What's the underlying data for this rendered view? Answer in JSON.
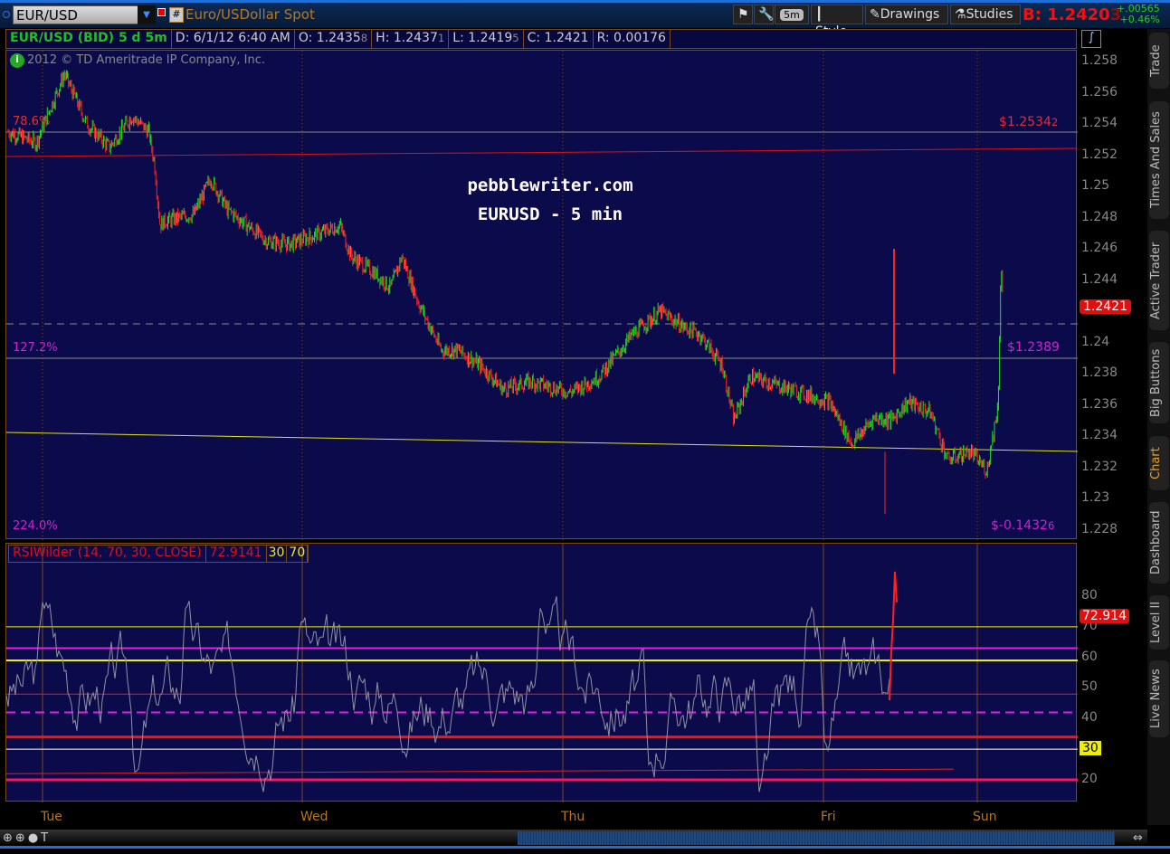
{
  "toolbar": {
    "symbol": "EUR/USD",
    "description": "Euro/USDollar Spot",
    "hash": "#",
    "timeframe": "5m",
    "style": "Style",
    "drawings": "Drawings",
    "studies": "Studies",
    "bid_label": "B:",
    "bid": "1.2420",
    "bid_small": "3",
    "change": "+.00565",
    "change_pct": "+0.46%"
  },
  "info": {
    "title": "EUR/USD (BID) 5 d 5m",
    "date": "D: 6/1/12 6:40 AM",
    "open": "O: 1.2435",
    "open_s": "8",
    "high": "H: 1.2437",
    "high_s": "1",
    "low": "L: 1.2419",
    "low_s": "5",
    "close": "C: 1.2421",
    "range": "R: 0.00176"
  },
  "copyright": "2012 © TD Ameritrade IP Company, Inc.",
  "watermark": {
    "line1": "pebblewriter.com",
    "line2": "EURUSD  -  5 min"
  },
  "fib": {
    "l1": "78.6%",
    "r1": "$1.2534",
    "r1s": "2",
    "l2": "127.2%",
    "r2": "$1.2389",
    "l3": "224.0%",
    "r3": "$-0.1432",
    "r3s": "6"
  },
  "price_axis": [
    "1.258",
    "1.256",
    "1.254",
    "1.252",
    "1.25",
    "1.248",
    "1.246",
    "1.244",
    "1.242",
    "1.24",
    "1.238",
    "1.236",
    "1.234",
    "1.232",
    "1.23",
    "1.228"
  ],
  "current_price": "1.2421",
  "rsi": {
    "label": "RSIWilder (14, 70, 30, CLOSE)",
    "value": "72.9141",
    "ob": "30",
    "os": "70",
    "axis": [
      "80",
      "70",
      "60",
      "50",
      "40",
      "30",
      "20"
    ],
    "current": "72.914",
    "marker30": "30"
  },
  "days": [
    "Tue",
    "Wed",
    "Thu",
    "Fri",
    "Sun"
  ],
  "side_tabs": [
    "Trade",
    "Times And Sales",
    "Active Trader",
    "Big Buttons",
    "Chart",
    "Dashboard",
    "Level II",
    "Live News"
  ],
  "colors": {
    "up": "#20e020",
    "down": "#ff2020",
    "bg": "#0b0b4c",
    "accent": "#b8771f"
  },
  "chart_data": {
    "type": "candlestick",
    "title": "EUR/USD 5m",
    "ylim": [
      1.228,
      1.259
    ],
    "price_path": [
      [
        0,
        1.2535
      ],
      [
        5,
        1.2528
      ],
      [
        10,
        1.2572
      ],
      [
        14,
        1.254
      ],
      [
        18,
        1.2525
      ],
      [
        22,
        1.2545
      ],
      [
        25,
        1.2535
      ],
      [
        26,
        1.2515
      ],
      [
        27,
        1.2475
      ],
      [
        28,
        1.2478
      ],
      [
        33,
        1.2482
      ],
      [
        36,
        1.2505
      ],
      [
        39,
        1.2485
      ],
      [
        46,
        1.2465
      ],
      [
        50,
        1.2463
      ],
      [
        54,
        1.2468
      ],
      [
        59,
        1.2475
      ],
      [
        61,
        1.2455
      ],
      [
        65,
        1.2445
      ],
      [
        68,
        1.2435
      ],
      [
        70,
        1.2455
      ],
      [
        73,
        1.2425
      ],
      [
        77,
        1.2395
      ],
      [
        80,
        1.2395
      ],
      [
        84,
        1.2385
      ],
      [
        88,
        1.237
      ],
      [
        93,
        1.2375
      ],
      [
        100,
        1.2368
      ],
      [
        105,
        1.2378
      ],
      [
        111,
        1.2405
      ],
      [
        116,
        1.242
      ],
      [
        120,
        1.241
      ],
      [
        123,
        1.2405
      ],
      [
        127,
        1.2385
      ],
      [
        129,
        1.235
      ],
      [
        132,
        1.2378
      ],
      [
        139,
        1.237
      ],
      [
        146,
        1.2362
      ],
      [
        150,
        1.2335
      ],
      [
        154,
        1.2352
      ],
      [
        157,
        1.235
      ],
      [
        160,
        1.2362
      ],
      [
        164,
        1.2355
      ],
      [
        167,
        1.2325
      ],
      [
        171,
        1.233
      ],
      [
        174,
        1.2318
      ],
      [
        176,
        1.236
      ],
      [
        176.5,
        1.245
      ],
      [
        177,
        1.2421
      ]
    ],
    "rsi_ylim": [
      15,
      90
    ]
  }
}
